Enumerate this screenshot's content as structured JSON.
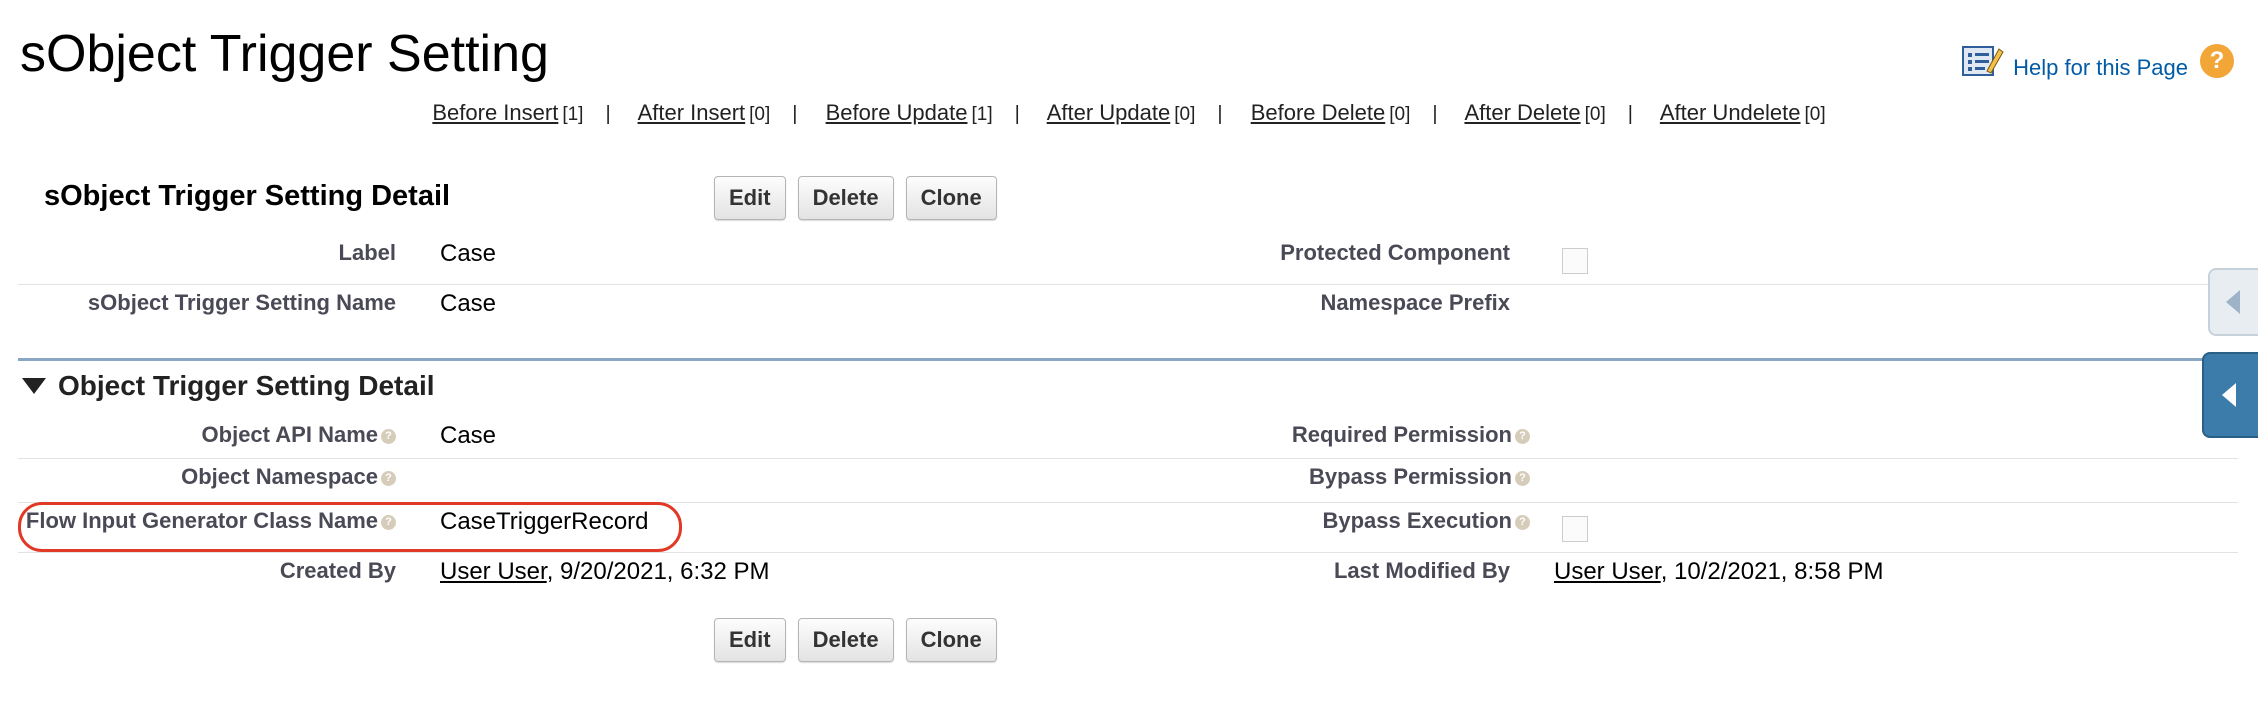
{
  "page": {
    "title": "sObject Trigger Setting",
    "help_link": "Help for this Page"
  },
  "event_links": [
    {
      "label": "Before Insert",
      "count": "[1]"
    },
    {
      "label": "After Insert",
      "count": "[0]"
    },
    {
      "label": "Before Update",
      "count": "[1]"
    },
    {
      "label": "After Update",
      "count": "[0]"
    },
    {
      "label": "Before Delete",
      "count": "[0]"
    },
    {
      "label": "After Delete",
      "count": "[0]"
    },
    {
      "label": "After Undelete",
      "count": "[0]"
    }
  ],
  "detail": {
    "title": "sObject Trigger Setting Detail",
    "buttons": {
      "edit": "Edit",
      "delete": "Delete",
      "clone": "Clone"
    },
    "fields": {
      "label": {
        "label": "Label",
        "value": "Case"
      },
      "protected_component": {
        "label": "Protected Component",
        "checked": false
      },
      "setting_name": {
        "label": "sObject Trigger Setting Name",
        "value": "Case"
      },
      "namespace_prefix": {
        "label": "Namespace Prefix",
        "value": ""
      }
    }
  },
  "object_detail": {
    "title": "Object Trigger Setting Detail",
    "fields": {
      "object_api_name": {
        "label": "Object API Name",
        "value": "Case"
      },
      "required_permission": {
        "label": "Required Permission",
        "value": ""
      },
      "object_namespace": {
        "label": "Object Namespace",
        "value": ""
      },
      "bypass_permission": {
        "label": "Bypass Permission",
        "value": ""
      },
      "flow_input_class": {
        "label": "Flow Input Generator Class Name",
        "value": "CaseTriggerRecord"
      },
      "bypass_execution": {
        "label": "Bypass Execution",
        "checked": false
      },
      "created_by": {
        "label": "Created By",
        "user": "User User",
        "date": ", 9/20/2021, 6:32 PM"
      },
      "last_modified_by": {
        "label": "Last Modified By",
        "user": "User User",
        "date": ", 10/2/2021, 8:58 PM"
      }
    }
  },
  "footer_buttons": {
    "edit": "Edit",
    "delete": "Delete",
    "clone": "Clone"
  },
  "colors": {
    "link": "#015ba7",
    "help_icon": "#f1a637",
    "highlight": "#e03a27",
    "section_rule": "#8aa6c5",
    "side_tab": "#3c7cab"
  },
  "icons": {
    "help_page": "list-pencil-icon",
    "help": "question-circle-icon",
    "info": "info-icon",
    "collapse": "triangle-down-icon",
    "side_tab": "chevron-left-icon"
  }
}
